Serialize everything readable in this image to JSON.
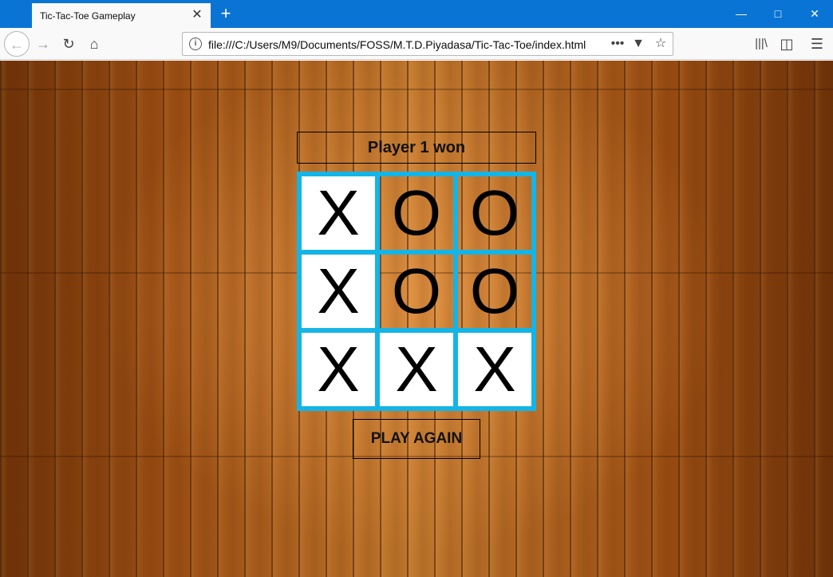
{
  "browser": {
    "tab_title": "Tic-Tac-Toe Gameplay",
    "url": "file:///C:/Users/M9/Documents/FOSS/M.T.D.Piyadasa/Tic-Tac-Toe/index.html",
    "accent_color": "#0a74d4"
  },
  "game": {
    "status": "Player 1 won",
    "play_again_label": "PLAY AGAIN",
    "board_border_color": "#14b4e6",
    "cells": [
      "X",
      "O",
      "O",
      "X",
      "O",
      "O",
      "X",
      "X",
      "X"
    ]
  }
}
